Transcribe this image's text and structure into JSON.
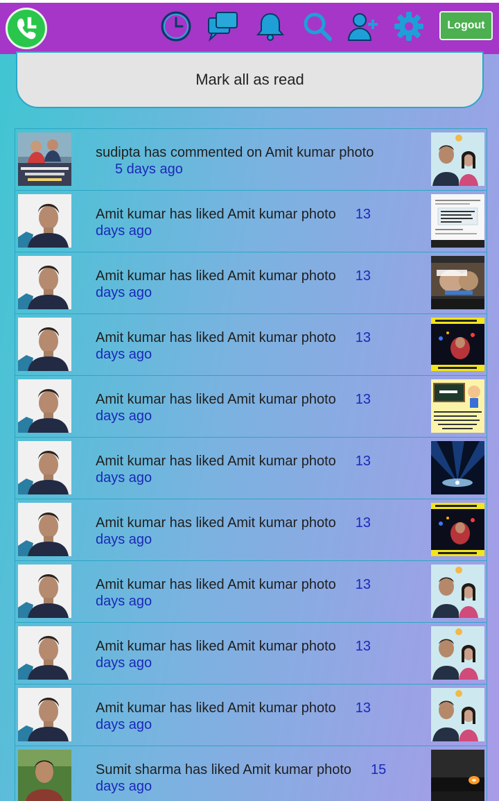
{
  "header": {
    "logout_label": "Logout",
    "icons": [
      "clock-icon",
      "chat-icon",
      "bell-icon",
      "search-icon",
      "add-user-icon",
      "gear-icon"
    ],
    "bar_color": "#a536c8"
  },
  "mark_all_label": "Mark all as read",
  "notifications": [
    {
      "message": "sudipta has commented on Amit kumar photo",
      "time": "5 days ago",
      "avatar": "couple-photo",
      "thumb": "selfie-two-people"
    },
    {
      "message": "Amit kumar has liked Amit kumar photo",
      "time": "13 days ago",
      "avatar": "man-portrait",
      "thumb": "text-quote-white"
    },
    {
      "message": "Amit kumar has liked Amit kumar photo",
      "time": "13 days ago",
      "avatar": "man-portrait",
      "thumb": "ooo-teri-meme"
    },
    {
      "message": "Amit kumar has liked Amit kumar photo",
      "time": "13 days ago",
      "avatar": "man-portrait",
      "thumb": "mechanical-waalo-poster"
    },
    {
      "message": "Amit kumar has liked Amit kumar photo",
      "time": "13 days ago",
      "avatar": "man-portrait",
      "thumb": "cartoon-math"
    },
    {
      "message": "Amit kumar has liked Amit kumar photo",
      "time": "13 days ago",
      "avatar": "man-portrait",
      "thumb": "blue-light-rays"
    },
    {
      "message": "Amit kumar has liked Amit kumar photo",
      "time": "13 days ago",
      "avatar": "man-portrait",
      "thumb": "mechanical-waalo-poster"
    },
    {
      "message": "Amit kumar has liked Amit kumar photo",
      "time": "13 days ago",
      "avatar": "man-portrait",
      "thumb": "selfie-two-people"
    },
    {
      "message": "Amit kumar has liked Amit kumar photo",
      "time": "13 days ago",
      "avatar": "man-portrait",
      "thumb": "selfie-two-people"
    },
    {
      "message": "Amit kumar has liked Amit kumar photo",
      "time": "13 days ago",
      "avatar": "man-portrait",
      "thumb": "selfie-two-people"
    },
    {
      "message": "Sumit sharma has liked Amit kumar photo",
      "time": "15 days ago",
      "avatar": "man-outdoor",
      "thumb": "dark-candle"
    }
  ]
}
